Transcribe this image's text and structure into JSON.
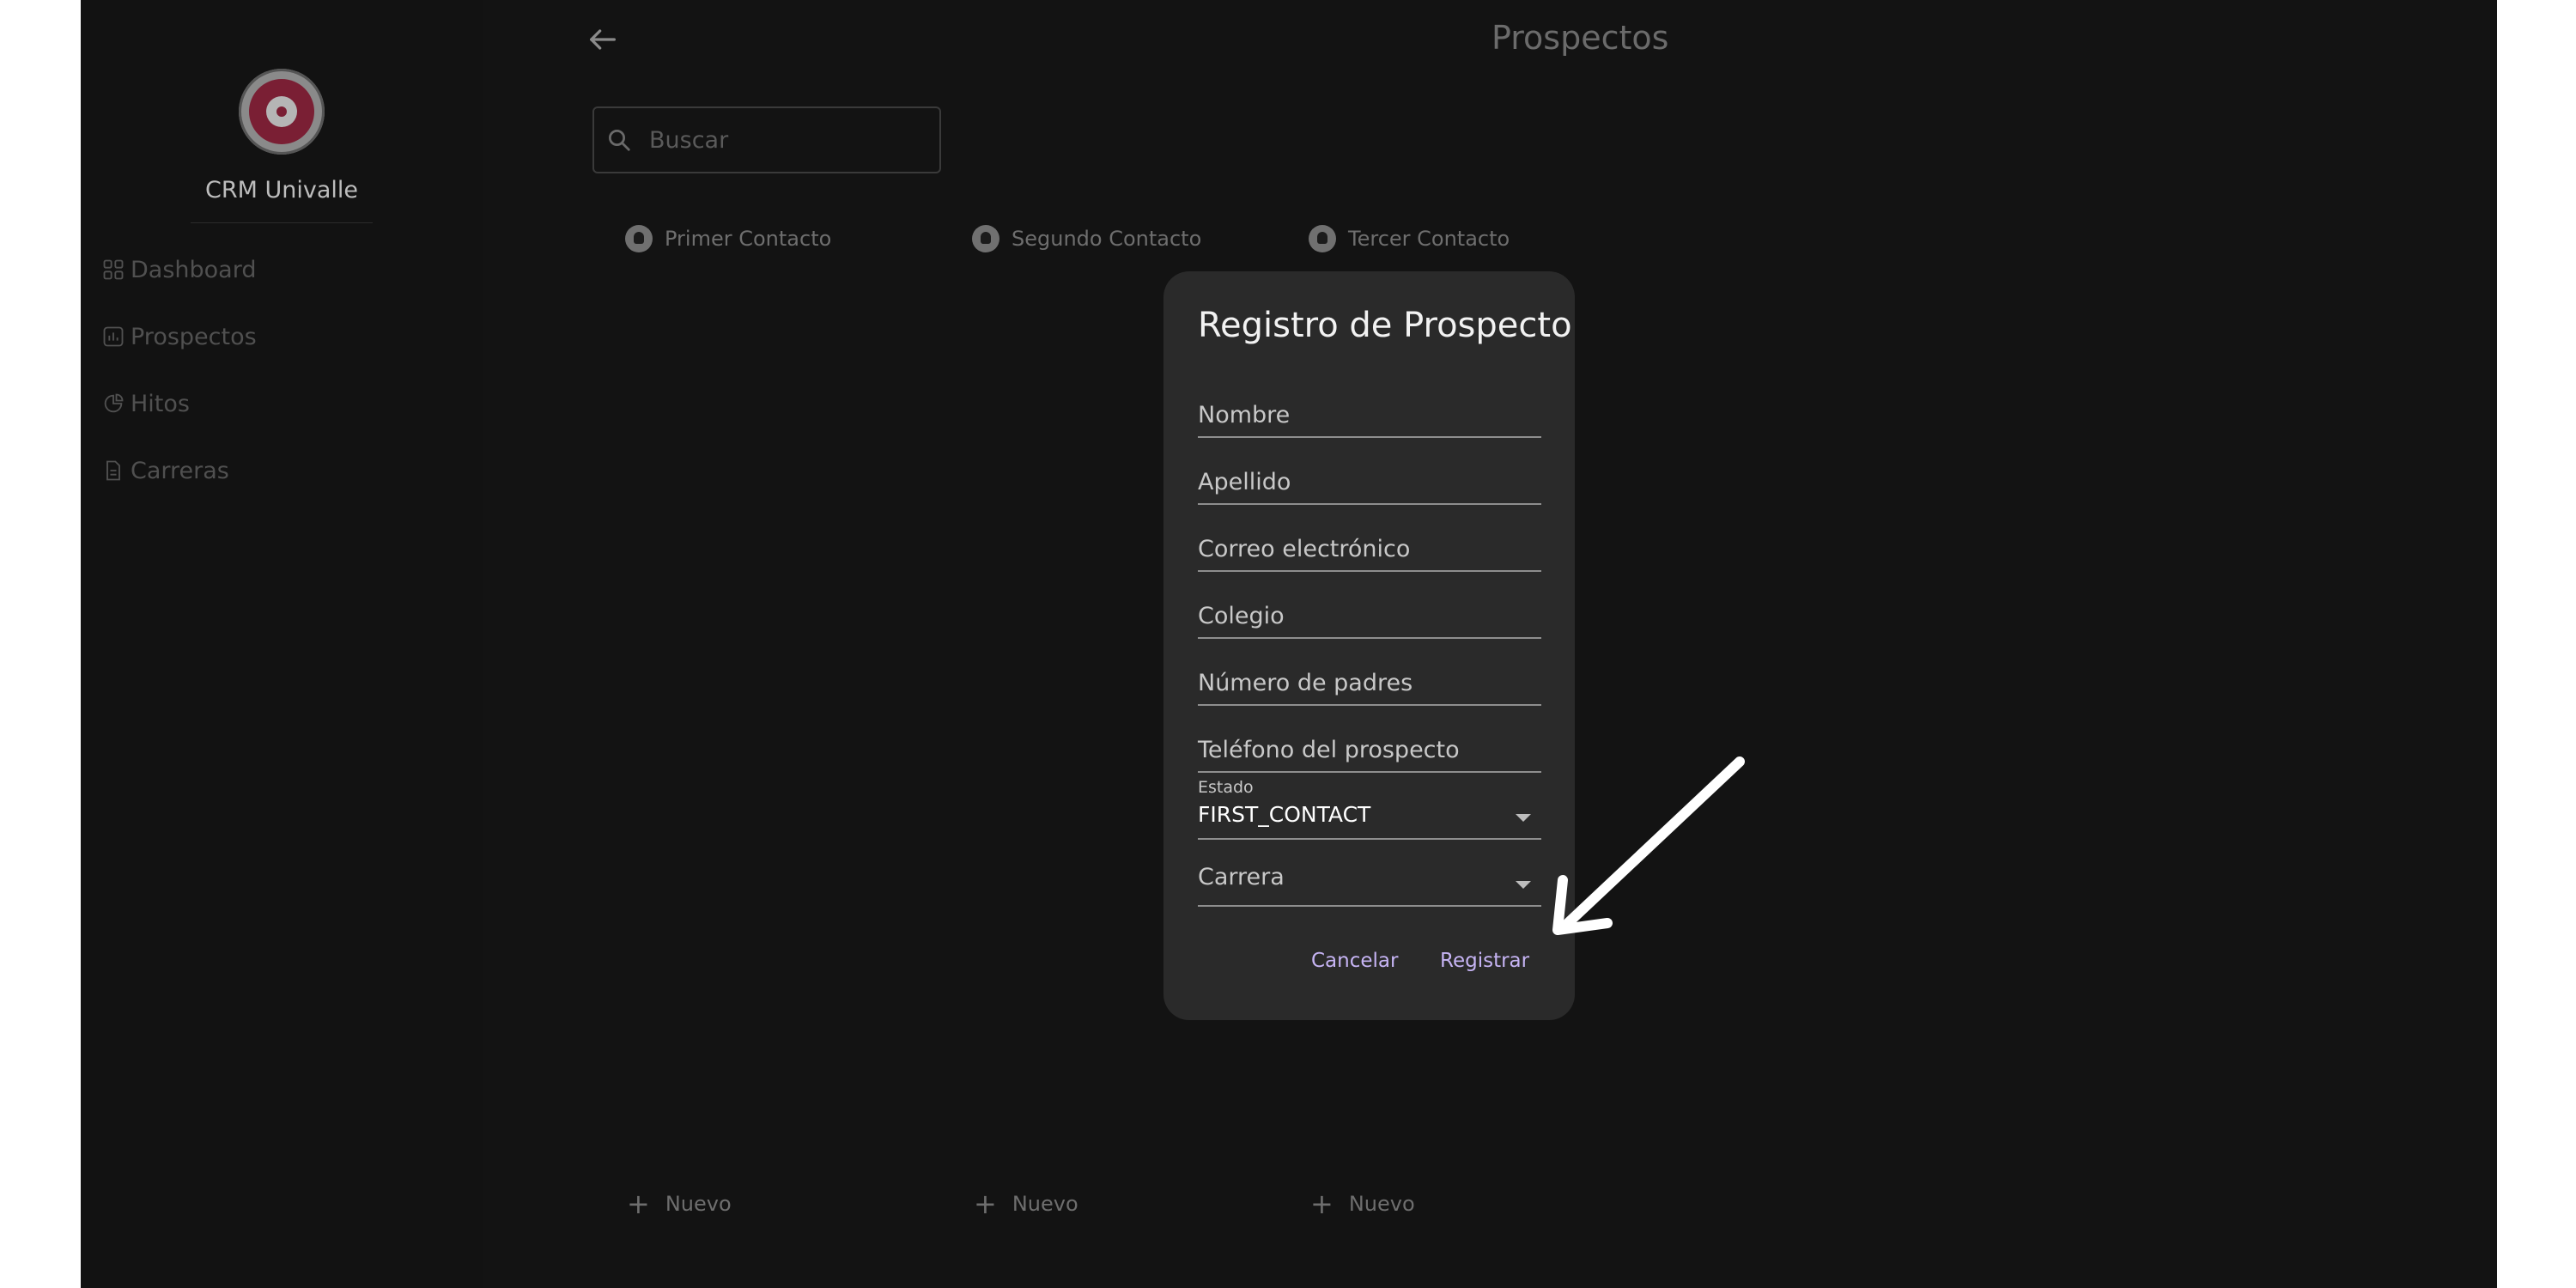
{
  "sidebar": {
    "app_title": "CRM Univalle",
    "items": [
      {
        "label": "Dashboard",
        "icon": "grid-icon"
      },
      {
        "label": "Prospectos",
        "icon": "chart-icon"
      },
      {
        "label": "Hitos",
        "icon": "pie-icon"
      },
      {
        "label": "Carreras",
        "icon": "document-icon"
      }
    ]
  },
  "header": {
    "title": "Prospectos",
    "back_icon": "arrow-left-icon"
  },
  "search": {
    "placeholder": "Buscar",
    "icon": "search-icon"
  },
  "columns": [
    {
      "title": "Primer Contacto",
      "new_label": "Nuevo"
    },
    {
      "title": "Segundo Contacto",
      "new_label": "Nuevo"
    },
    {
      "title": "Tercer Contacto",
      "new_label": "Nuevo"
    }
  ],
  "dialog": {
    "title": "Registro de Prospecto",
    "fields": {
      "nombre": "Nombre",
      "apellido": "Apellido",
      "correo": "Correo electrónico",
      "colegio": "Colegio",
      "numero_padres": "Número de padres",
      "telefono": "Teléfono del prospecto"
    },
    "estado": {
      "label": "Estado",
      "value": "FIRST_CONTACT"
    },
    "carrera": {
      "label": "Carrera"
    },
    "cancel_label": "Cancelar",
    "submit_label": "Registrar"
  },
  "colors": {
    "accent": "#c6b4f4",
    "background": "#121212",
    "dialog": "#2a2a2a"
  }
}
